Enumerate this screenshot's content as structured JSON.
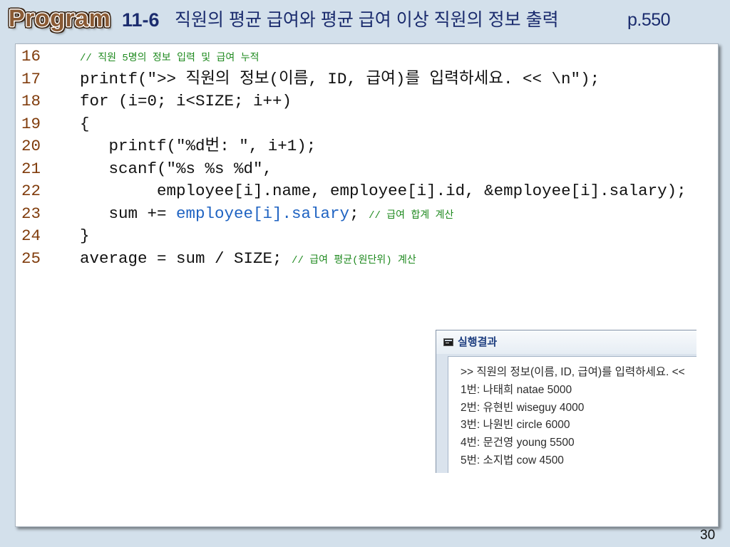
{
  "header": {
    "badge": "Program",
    "section": "11-6",
    "title": "직원의 평균 급여와 평균 급여 이상 직원의 정보 출력",
    "page_ref": "p.550"
  },
  "code": {
    "lines": [
      {
        "num": "16",
        "comment": "// 직원 5명의 정보 입력 및 급여 누적"
      },
      {
        "num": "17",
        "text": "printf(\">> 직원의 정보(이름, ID, 급여)를 입력하세요. << \\n\");"
      },
      {
        "num": "18",
        "text": "for (i=0; i<SIZE; i++)"
      },
      {
        "num": "19",
        "text": "{"
      },
      {
        "num": "20",
        "text": "printf(\"%d번: \", i+1);"
      },
      {
        "num": "21",
        "text": "scanf(\"%s %s %d\","
      },
      {
        "num": "22",
        "text": "employee[i].name, employee[i].id, &employee[i].salary);"
      },
      {
        "num": "23",
        "text": "sum +=",
        "highlight": "employee[i].salary",
        "text_after": ";",
        "comment": "// 급여 합계 계산"
      },
      {
        "num": "24",
        "text": "}"
      },
      {
        "num": "25",
        "text": "average = sum / SIZE;",
        "comment": "// 급여 평균(원단위) 계산"
      }
    ]
  },
  "output": {
    "icon": "console-icon",
    "title": "실행결과",
    "lines": [
      ">> 직원의 정보(이름, ID, 급여)를 입력하세요. <<",
      "1번: 나태희 natae 5000",
      "2번: 유현빈 wiseguy 4000",
      "3번: 나원빈 circle 6000",
      "4번: 문건영 young 5500",
      "5번: 소지법 cow 4500"
    ]
  },
  "footer": {
    "page_number": "30"
  },
  "colors": {
    "slide_background": "#d3e0eb",
    "header_text": "#1b2c6e",
    "badge": "#8a5a34",
    "line_number": "#803c0c",
    "code_text": "#111111",
    "comment": "#1f8a1f",
    "highlight": "#1f63c2",
    "output_title": "#1f3f80"
  }
}
